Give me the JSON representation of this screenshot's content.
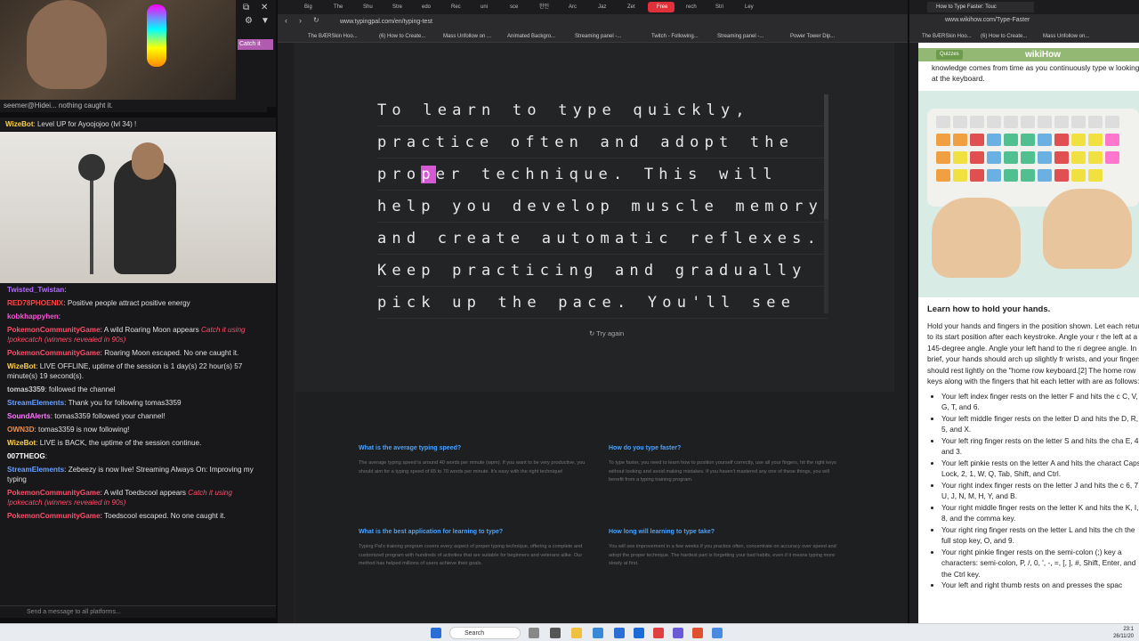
{
  "stream": {
    "top_chat": "seemer@Hidei... nothing caught it.",
    "catch_label": "Catch it",
    "level_message": {
      "user": "WizeBot",
      "text": "Level UP for Ayoojojoo (lvl 34) !"
    },
    "chat": [
      {
        "user": "Twisted_Twistan",
        "color": "#b36bff",
        "text": ""
      },
      {
        "user": "RED78PHOENIX",
        "color": "#ff4444",
        "text": "Positive people attract positive energy"
      },
      {
        "user": "kobkhappyhen",
        "color": "#ff4fd8",
        "text": ""
      },
      {
        "user": "PokemonCommunityGame",
        "color": "#ff4d6a",
        "text": "A wild Roaring Moon appears",
        "italic": "Catch it using !pokecatch (winners revealed in 90s)"
      },
      {
        "user": "PokemonCommunityGame",
        "color": "#ff4d6a",
        "text": "Roaring Moon escaped. No one caught it."
      },
      {
        "user": "WizeBot",
        "color": "#ffd24a",
        "text": "LIVE OFFLINE, uptime of the session is 1 day(s) 22 hour(s) 57 minute(s) 19 second(s)."
      },
      {
        "user": "tomas3359",
        "color": "#cccccc",
        "text": "followed the channel"
      },
      {
        "user": "StreamElements",
        "color": "#6aa0ff",
        "text": "Thank you for following tomas3359"
      },
      {
        "user": "SoundAlerts",
        "color": "#ff77ff",
        "text": "tomas3359 followed your channel!"
      },
      {
        "user": "OWN3D",
        "color": "#ff8c3a",
        "text": "tomas3359 is now following!"
      },
      {
        "user": "WizeBot",
        "color": "#ffd24a",
        "text": "LIVE is BACK, the uptime of the session continue."
      },
      {
        "user": "007THEOG",
        "color": "#ffffff",
        "text": ""
      },
      {
        "user": "StreamElements",
        "color": "#6aa0ff",
        "text": "Zebeezy is now live! Streaming Always On: Improving my typing"
      },
      {
        "user": "PokemonCommunityGame",
        "color": "#ff4d6a",
        "text": "A wild Toedscool appears",
        "italic": "Catch it using !pokecatch (winners revealed in 90s)"
      },
      {
        "user": "PokemonCommunityGame",
        "color": "#ff4d6a",
        "text": "Toedscool escaped. No one caught it."
      }
    ],
    "chat_placeholder": "Send a message to all platforms..."
  },
  "mid": {
    "tabs": [
      "Big",
      "The",
      "Shu",
      "Stre",
      "edo",
      "Rec",
      "uni",
      "sce",
      "한인",
      "Arc",
      "Jaz",
      "Zet",
      "Free",
      "rech",
      "Stri",
      "Ley"
    ],
    "active_tab": 12,
    "url": "www.typingpal.com/en/typing-test",
    "bookmarks": [
      "The BÆRSkin Hoo...",
      "(6) How to Create...",
      "Mass Unfollow on ...",
      "Animated Backgro...",
      "Streaming panel -...",
      "Twitch - Following...",
      "Streaming panel -...",
      "Power Tower Dip..."
    ],
    "typing_lines": [
      {
        "before": "To learn to type quickly,",
        "cursor": "",
        "after": ""
      },
      {
        "before": "practice often and adopt the",
        "cursor": "",
        "after": ""
      },
      {
        "before": "pro",
        "cursor": "p",
        "after": "er technique. This will"
      },
      {
        "before": "help you develop muscle memory",
        "cursor": "",
        "after": ""
      },
      {
        "before": "and create automatic reflexes.",
        "cursor": "",
        "after": ""
      },
      {
        "before": "Keep practicing and gradually",
        "cursor": "",
        "after": ""
      },
      {
        "before": "pick up the pace. You'll see",
        "cursor": "",
        "after": ""
      }
    ],
    "try_again": "Try again",
    "faq": [
      {
        "q": "What is the average typing speed?",
        "a": "The average typing speed is around 40 words per minute (wpm). If you want to be very productive, you should aim for a typing speed of 65 to 70 words per minute. It's easy with the right technique!"
      },
      {
        "q": "How do you type faster?",
        "a": "To type faster, you need to learn how to position yourself correctly, use all your fingers, hit the right keys without looking and avoid making mistakes. If you haven't mastered any one of these things, you will benefit from a typing training program."
      },
      {
        "q": "What is the best application for learning to type?",
        "a": "Typing Pal's training program covers every aspect of proper typing technique, offering a complete and customized program with hundreds of activities that are suitable for beginners and veterans alike. Our method has helped millions of users achieve their goals."
      },
      {
        "q": "How long will learning to type take?",
        "a": "You will see improvement in a few weeks if you practice often, concentrate on accuracy over speed and adopt the proper technique. The hardest part is forgetting your bad habits, even if it means typing more slowly at first."
      }
    ]
  },
  "right": {
    "tab_title": "How to Type Faster: Touc",
    "url": "www.wikihow.com/Type-Faster",
    "bookmarks": [
      "The BÆRSkin Hoo...",
      "(6) How to Create...",
      "Mass Unfollow on..."
    ],
    "quizzes": "Quizzes",
    "logo": "wikiHow",
    "intro": "knowledge comes from time as you continuously type w looking at the keyboard.",
    "heading": "Learn how to hold your hands.",
    "paragraph": "Hold your hands and fingers in the position shown. Let each return to its start position after each keystroke. Angle your r the left at a 145-degree angle. Angle your left hand to the ri degree angle. In brief, your hands should arch up slightly fr wrists, and your fingers should rest lightly on the \"home row keyboard.[2] The home row keys along with the fingers that hit each letter with are as follows:",
    "bullets": [
      "Your left index finger rests on the letter F and hits the c C, V, G, T, and 6.",
      "Your left middle finger rests on the letter D and hits the D, R, 5, and X.",
      "Your left ring finger rests on the letter S and hits the cha E, 4, and 3.",
      "Your left pinkie rests on the letter A and hits the charact Caps Lock, 2, 1, W, Q, Tab, Shift, and Ctrl.",
      "Your right index finger rests on the letter J and hits the c 6, 7, U, J, N, M, H, Y, and B.",
      "Your right middle finger rests on the letter K and hits the K, I, 8, and the comma key.",
      "Your right ring finger rests on the letter L and hits the ch the full stop key, O, and 9.",
      "Your right pinkie finger rests on the semi-colon (;) key a characters: semi-colon, P, /, 0, ', -, =, [, ], #, Shift, Enter, and the Ctrl key.",
      "Your left and right thumb rests on and presses the spac"
    ]
  },
  "taskbar": {
    "search": "Search",
    "time": "23:1",
    "date": "26/11/20"
  }
}
